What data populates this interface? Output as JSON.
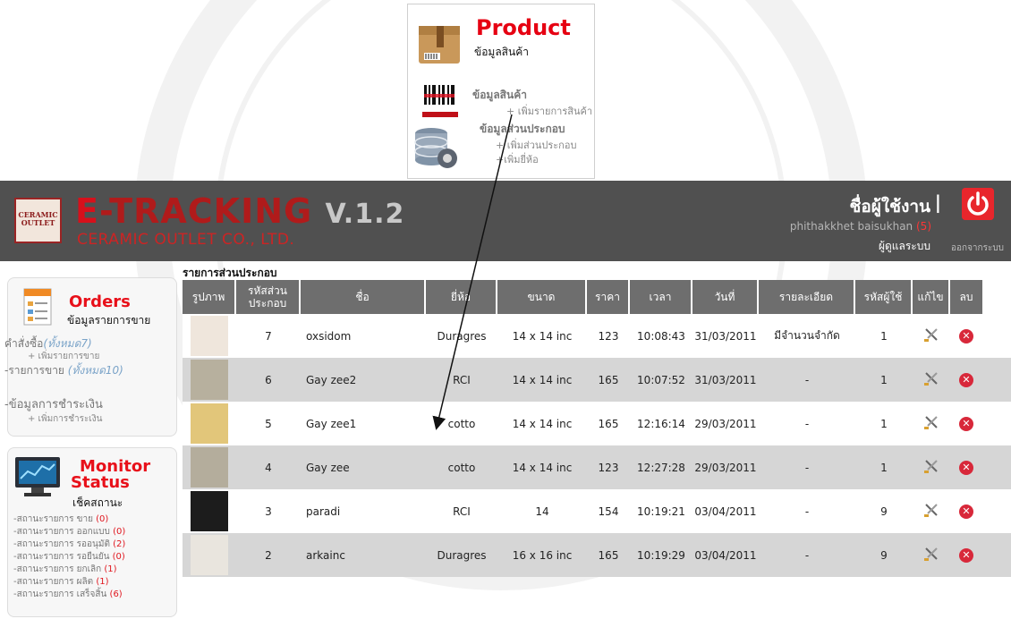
{
  "product_panel": {
    "title": "Product",
    "subtitle": "ข้อมูลสินค้า",
    "menu": [
      {
        "heading": "ข้อมูลสินค้า",
        "items": [
          "+ เพิ่มรายการสินค้า"
        ]
      },
      {
        "heading": "ข้อมูลส่วนประกอบ",
        "items": [
          "+ เพิ่มส่วนประกอบ",
          "+เพิ่มยี่ห้อ"
        ]
      }
    ]
  },
  "header": {
    "brand_letter": "E",
    "brand_rest": "-TRACKING",
    "version": "V.1.2",
    "company": "CERAMIC OUTLET CO., LTD.",
    "logo_text": "CERAMIC OUTLET",
    "user_label": "ชื่อผู้ใช้งาน",
    "separator": "|",
    "user_name": "phithakkhet baisukhan",
    "user_count": "(5)",
    "user_role": "ผู้ดูแลระบบ",
    "logout_label": "ออกจากระบบ"
  },
  "sidebar": {
    "orders": {
      "title": "Orders",
      "subtitle": "ข้อมูลรายการขาย",
      "links": [
        {
          "label": "คำสั่งซื้อ",
          "note": "(ทั้งหมด7)"
        },
        {
          "label": "+ เพิ่มรายการขาย"
        },
        {
          "label": "-รายการขาย",
          "note": "(ทั้งหมด10)"
        },
        {
          "label": "-ข้อมูลการชำระเงิน"
        },
        {
          "label": "+ เพิ่มการชำระเงิน"
        }
      ]
    },
    "monitor": {
      "title_line1": "Monitor",
      "title_line2": "Status",
      "subtitle": "เช็คสถานะ",
      "statuses": [
        {
          "label": "-สถานะรายการ ขาย",
          "count": "(0)"
        },
        {
          "label": "-สถานะรายการ ออกแบบ",
          "count": "(0)"
        },
        {
          "label": "-สถานะรายการ รออนุมัติ",
          "count": "(2)"
        },
        {
          "label": "-สถานะรายการ รอยืนยัน",
          "count": "(0)"
        },
        {
          "label": "-สถานะรายการ ยกเลิก",
          "count": "(1)"
        },
        {
          "label": "-สถานะรายการ ผลิต",
          "count": "(1)"
        },
        {
          "label": "-สถานะรายการ เสร็จสิ้น",
          "count": "(6)"
        }
      ]
    }
  },
  "table": {
    "caption": "รายการส่วนประกอบ",
    "columns": [
      "รูปภาพ",
      "รหัสส่วน ประกอบ",
      "ชื่อ",
      "ยี่ห้อ",
      "ขนาด",
      "ราคา",
      "เวลา",
      "วันที่",
      "รายละเอียด",
      "รหัสผู้ใช้",
      "แก้ไข",
      "ลบ"
    ],
    "rows": [
      {
        "id": "7",
        "name": "oxsidom",
        "brand": "Duragres",
        "size": "14 x 14 inc",
        "price": "123",
        "time": "10:08:43",
        "date": "31/03/2011",
        "detail": "มีจำนวนจำกัด",
        "user": "1",
        "thumb": "#efe6dc"
      },
      {
        "id": "6",
        "name": "Gay zee2",
        "brand": "RCI",
        "size": "14 x 14 inc",
        "price": "165",
        "time": "10:07:52",
        "date": "31/03/2011",
        "detail": "-",
        "user": "1",
        "thumb": "#b7b09e"
      },
      {
        "id": "5",
        "name": "Gay zee1",
        "brand": "cotto",
        "size": "14 x 14 inc",
        "price": "165",
        "time": "12:16:14",
        "date": "29/03/2011",
        "detail": "-",
        "user": "1",
        "thumb": "#e2c67a"
      },
      {
        "id": "4",
        "name": "Gay zee",
        "brand": "cotto",
        "size": "14 x 14 inc",
        "price": "123",
        "time": "12:27:28",
        "date": "29/03/2011",
        "detail": "-",
        "user": "1",
        "thumb": "#b4ad9c"
      },
      {
        "id": "3",
        "name": "paradi",
        "brand": "RCI",
        "size": "14",
        "price": "154",
        "time": "10:19:21",
        "date": "03/04/2011",
        "detail": "-",
        "user": "9",
        "thumb": "#1c1c1c"
      },
      {
        "id": "2",
        "name": "arkainc",
        "brand": "Duragres",
        "size": "16 x 16 inc",
        "price": "165",
        "time": "10:19:29",
        "date": "03/04/2011",
        "detail": "-",
        "user": "9",
        "thumb": "#e9e5de"
      }
    ]
  },
  "colors": {
    "accent": "#e8101a",
    "header_bg": "#505050",
    "table_header": "#6e6e6e"
  }
}
